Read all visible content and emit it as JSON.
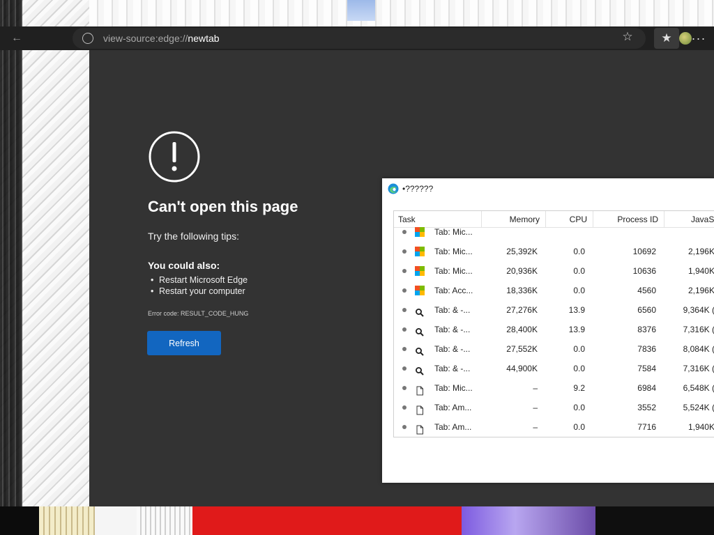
{
  "browser": {
    "address": {
      "prefix": "view-source:edge://",
      "host": "newtab"
    },
    "icons": {
      "back": "back-arrow-icon",
      "site_info": "site-info-icon",
      "favorite": "star-icon",
      "collections": "favorites-list-icon",
      "menu": "more-dots-icon"
    }
  },
  "error_page": {
    "title": "Can't open this page",
    "tips": "Try the following tips:",
    "also_heading": "You could also:",
    "suggestions": [
      "Restart Microsoft Edge",
      "Restart your computer"
    ],
    "error_code": "Error code: RESULT_CODE_HUNG",
    "refresh_label": "Refresh",
    "accent_color": "#1266c0"
  },
  "task_manager": {
    "title": "•??????",
    "columns": [
      "Task",
      "Memory",
      "CPU",
      "Process ID",
      "JavaSc"
    ],
    "rows": [
      {
        "icon": "microsoft-logo-icon",
        "task": "Tab: Mic...",
        "memory": "",
        "cpu": "",
        "pid": "",
        "js": ""
      },
      {
        "icon": "microsoft-logo-icon",
        "task": "Tab: Mic...",
        "memory": "25,392K",
        "cpu": "0.0",
        "pid": "10692",
        "js": "2,196K"
      },
      {
        "icon": "microsoft-logo-icon",
        "task": "Tab: Mic...",
        "memory": "20,936K",
        "cpu": "0.0",
        "pid": "10636",
        "js": "1,940K"
      },
      {
        "icon": "microsoft-logo-icon",
        "task": "Tab: Acc...",
        "memory": "18,336K",
        "cpu": "0.0",
        "pid": "4560",
        "js": "2,196K"
      },
      {
        "icon": "search-icon",
        "task": "Tab: & -...",
        "memory": "27,276K",
        "cpu": "13.9",
        "pid": "6560",
        "js": "9,364K ("
      },
      {
        "icon": "search-icon",
        "task": "Tab: & -...",
        "memory": "28,400K",
        "cpu": "13.9",
        "pid": "8376",
        "js": "7,316K ("
      },
      {
        "icon": "search-icon",
        "task": "Tab: & -...",
        "memory": "27,552K",
        "cpu": "0.0",
        "pid": "7836",
        "js": "8,084K ("
      },
      {
        "icon": "search-icon",
        "task": "Tab: & -...",
        "memory": "44,900K",
        "cpu": "0.0",
        "pid": "7584",
        "js": "7,316K ("
      },
      {
        "icon": "document-icon",
        "task": "Tab: Mic...",
        "memory": "–",
        "cpu": "9.2",
        "pid": "6984",
        "js": "6,548K ("
      },
      {
        "icon": "document-icon",
        "task": "Tab: Am...",
        "memory": "–",
        "cpu": "0.0",
        "pid": "3552",
        "js": "5,524K ("
      },
      {
        "icon": "document-icon",
        "task": "Tab: Am...",
        "memory": "–",
        "cpu": "0.0",
        "pid": "7716",
        "js": "1,940K"
      }
    ]
  }
}
